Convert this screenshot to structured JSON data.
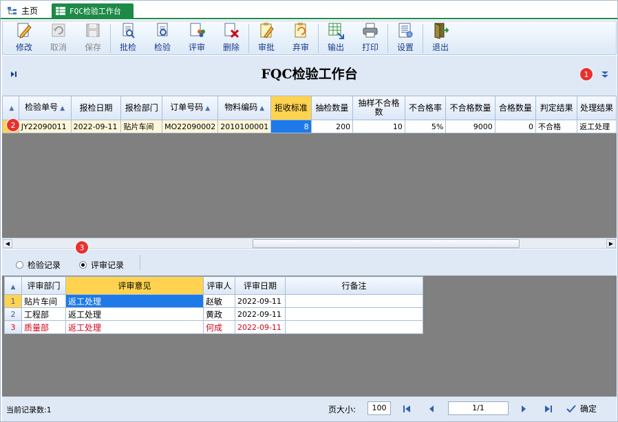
{
  "tabs": [
    {
      "label": "主页"
    },
    {
      "label": "FQC检验工作台"
    }
  ],
  "toolbar": {
    "buttons": [
      {
        "label": "修改",
        "icon": "edit-icon",
        "enabled": true
      },
      {
        "label": "取消",
        "icon": "undo-icon",
        "enabled": false
      },
      {
        "label": "保存",
        "icon": "save-icon",
        "enabled": false
      },
      {
        "label": "批检",
        "icon": "batch-inspect-icon",
        "enabled": true
      },
      {
        "label": "检验",
        "icon": "inspect-icon",
        "enabled": true
      },
      {
        "label": "评审",
        "icon": "review-icon",
        "enabled": true
      },
      {
        "label": "删除",
        "icon": "delete-icon",
        "enabled": true
      },
      {
        "label": "审批",
        "icon": "approve-icon",
        "enabled": true
      },
      {
        "label": "弃审",
        "icon": "unapprove-icon",
        "enabled": true
      },
      {
        "label": "输出",
        "icon": "export-icon",
        "enabled": true
      },
      {
        "label": "打印",
        "icon": "print-icon",
        "enabled": true
      },
      {
        "label": "设置",
        "icon": "settings-icon",
        "enabled": true
      },
      {
        "label": "退出",
        "icon": "exit-icon",
        "enabled": true
      }
    ]
  },
  "page": {
    "title": "FQC检验工作台",
    "badge1": "1",
    "badge2": "2",
    "badge3": "3"
  },
  "main_grid": {
    "columns": [
      "检验单号",
      "报检日期",
      "报检部门",
      "订单号码",
      "物料编码",
      "拒收标准",
      "抽检数量",
      "抽样不合格数",
      "不合格率",
      "不合格数量",
      "合格数量",
      "判定结果",
      "处理结果"
    ],
    "rows": [
      [
        "JY22090011",
        "2022-09-11",
        "贴片车间",
        "MO22090002",
        "2010100001",
        "8",
        "200",
        "10",
        "5%",
        "9000",
        "0",
        "不合格",
        "返工处理"
      ]
    ]
  },
  "radio": {
    "option1": "检验记录",
    "option2": "评审记录",
    "selected": "评审记录"
  },
  "sub_grid": {
    "columns": [
      "评审部门",
      "评审意见",
      "评审人",
      "评审日期",
      "行备注"
    ],
    "rows": [
      {
        "no": "1",
        "dept": "贴片车间",
        "opinion": "返工处理",
        "reviewer": "赵敏",
        "date": "2022-09-11",
        "note": ""
      },
      {
        "no": "2",
        "dept": "工程部",
        "opinion": "返工处理",
        "reviewer": "黄政",
        "date": "2022-09-11",
        "note": ""
      },
      {
        "no": "3",
        "dept": "质量部",
        "opinion": "返工处理",
        "reviewer": "何成",
        "date": "2022-09-11",
        "note": ""
      }
    ]
  },
  "status": {
    "record_count": "当前记录数:1",
    "page_size_label": "页大小:",
    "page_size": "100",
    "page_indicator": "1/1",
    "confirm_label": "确定"
  },
  "colors": {
    "tab_active": "#1e8a47",
    "header_highlight": "#ffd34f",
    "selection": "#1e7ae8",
    "badge": "#e8312f",
    "alert_text": "#d0021b"
  }
}
